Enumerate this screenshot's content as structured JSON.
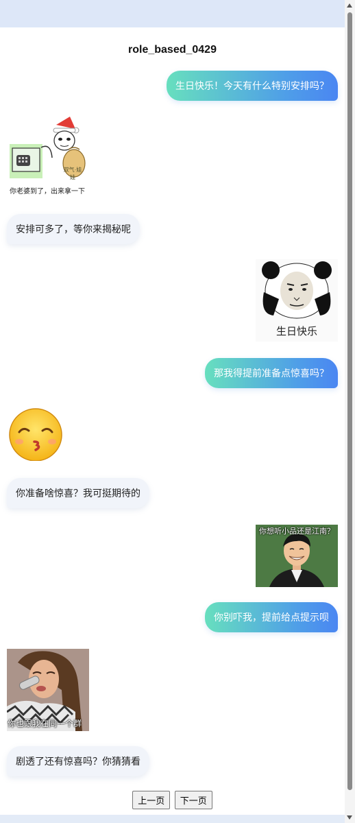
{
  "page": {
    "title": "role_based_0429"
  },
  "messages": [
    {
      "type": "text",
      "role": "user",
      "text": "生日快乐！今天有什么特别安排吗？"
    },
    {
      "type": "sticker",
      "role": "bot",
      "caption": "你老婆到了，出来拿一下",
      "sticker_text": "双气·娃娃"
    },
    {
      "type": "text",
      "role": "bot",
      "text": "安排可多了，等你来揭秘呢"
    },
    {
      "type": "sticker",
      "role": "user",
      "caption": "生日快乐"
    },
    {
      "type": "text",
      "role": "user",
      "text": "那我得提前准备点惊喜吗？"
    },
    {
      "type": "sticker",
      "role": "bot"
    },
    {
      "type": "text",
      "role": "bot",
      "text": "你准备啥惊喜？我可挺期待的"
    },
    {
      "type": "sticker",
      "role": "user",
      "caption": "你想听小品还是江南？"
    },
    {
      "type": "text",
      "role": "user",
      "text": "你别吓我，提前给点提示呗"
    },
    {
      "type": "sticker",
      "role": "bot",
      "caption": "你也跟我在同一个群"
    },
    {
      "type": "text",
      "role": "bot",
      "text": "剧透了还有惊喜吗？你猜猜看"
    }
  ],
  "pagination": {
    "prev_label": "上一页",
    "next_label": "下一页"
  },
  "colors": {
    "user_bubble_start": "#67dfbe",
    "user_bubble_end": "#4a86f2",
    "bot_bubble": "#f1f4fa",
    "page_background": "#dde7f8"
  }
}
